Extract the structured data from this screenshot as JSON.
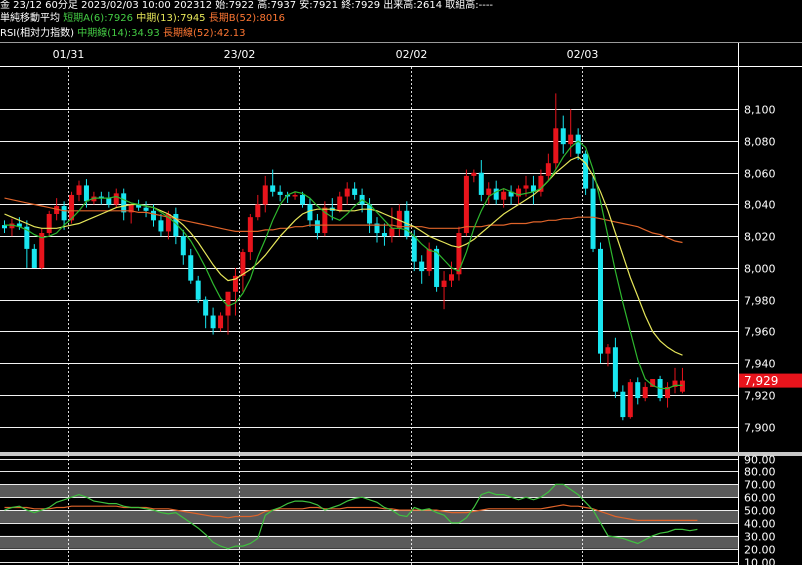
{
  "header": {
    "line1": "金 23/12 60分足 2023/02/03 10:00 202312 始:7922 高:7937 安:7921 終:7929 出来高:2614 取組高:----",
    "ma_title": "単純移動平均",
    "ma_short": "短期A(6):7926",
    "ma_mid": "中期(13):7945",
    "ma_long": "長期B(52):8016",
    "rsi_title": "RSI(相対力指数)",
    "rsi_mid": "中期線(14):34.93",
    "rsi_long": "長期線(52):42.13"
  },
  "colors": {
    "up": "#e8141c",
    "down": "#19e6f0",
    "ma_short": "#2eb82e",
    "ma_mid": "#e6e65a",
    "ma_long": "#e0642a",
    "rsi_mid": "#3fc13f",
    "rsi_long": "#e0642a",
    "grid": "#ffffff",
    "price_marker": "#e8141c"
  },
  "chart_data": [
    {
      "type": "candlestick",
      "x_dates": [
        {
          "label": "01/31",
          "index": 9
        },
        {
          "label": "23/02",
          "index": 32
        },
        {
          "label": "02/02",
          "index": 55
        },
        {
          "label": "02/03",
          "index": 78
        }
      ],
      "y_ticks": [
        "8,100",
        "8,080",
        "8,060",
        "8,040",
        "8,020",
        "8,000",
        "7,980",
        "7,960",
        "7,940",
        "7,920",
        "7,900"
      ],
      "ylim": [
        7884,
        8126
      ],
      "last_price_label": "7,929",
      "last_price": 7929,
      "candles": [
        [
          8027,
          8030,
          8022,
          8025
        ],
        [
          8025,
          8031,
          8020,
          8028
        ],
        [
          8028,
          8032,
          8024,
          8026
        ],
        [
          8026,
          8030,
          8000,
          8012
        ],
        [
          8012,
          8015,
          8000,
          8000
        ],
        [
          8000,
          8025,
          7999,
          8022
        ],
        [
          8022,
          8036,
          8020,
          8034
        ],
        [
          8034,
          8044,
          8030,
          8039
        ],
        [
          8039,
          8042,
          8024,
          8030
        ],
        [
          8030,
          8048,
          8028,
          8046
        ],
        [
          8046,
          8055,
          8042,
          8052
        ],
        [
          8052,
          8056,
          8038,
          8042
        ],
        [
          8042,
          8048,
          8040,
          8045
        ],
        [
          8045,
          8048,
          8040,
          8044
        ],
        [
          8044,
          8048,
          8038,
          8040
        ],
        [
          8040,
          8050,
          8038,
          8047
        ],
        [
          8047,
          8050,
          8030,
          8035
        ],
        [
          8035,
          8040,
          8028,
          8040
        ],
        [
          8040,
          8043,
          8036,
          8038
        ],
        [
          8038,
          8042,
          8032,
          8036
        ],
        [
          8036,
          8040,
          8026,
          8030
        ],
        [
          8030,
          8034,
          8020,
          8023
        ],
        [
          8023,
          8036,
          8018,
          8034
        ],
        [
          8034,
          8038,
          8015,
          8020
        ],
        [
          8020,
          8024,
          8002,
          8008
        ],
        [
          8008,
          8012,
          7990,
          7992
        ],
        [
          7992,
          7995,
          7978,
          7980
        ],
        [
          7980,
          7982,
          7962,
          7970
        ],
        [
          7970,
          7975,
          7958,
          7962
        ],
        [
          7962,
          7972,
          7960,
          7970
        ],
        [
          7970,
          7982,
          7958,
          7985
        ],
        [
          7985,
          8000,
          7970,
          7995
        ],
        [
          7995,
          8012,
          7985,
          8010
        ],
        [
          8010,
          8034,
          8005,
          8032
        ],
        [
          8032,
          8046,
          8030,
          8040
        ],
        [
          8040,
          8058,
          8035,
          8052
        ],
        [
          8052,
          8062,
          8045,
          8048
        ],
        [
          8048,
          8052,
          8042,
          8046
        ],
        [
          8046,
          8048,
          8041,
          8045
        ],
        [
          8045,
          8048,
          8043,
          8046
        ],
        [
          8046,
          8048,
          8038,
          8040
        ],
        [
          8040,
          8044,
          8026,
          8030
        ],
        [
          8030,
          8034,
          8018,
          8022
        ],
        [
          8022,
          8042,
          8020,
          8038
        ],
        [
          8038,
          8044,
          8030,
          8036
        ],
        [
          8036,
          8048,
          8035,
          8045
        ],
        [
          8045,
          8054,
          8040,
          8050
        ],
        [
          8050,
          8054,
          8043,
          8046
        ],
        [
          8046,
          8050,
          8035,
          8040
        ],
        [
          8040,
          8044,
          8022,
          8028
        ],
        [
          8028,
          8032,
          8016,
          8022
        ],
        [
          8022,
          8028,
          8014,
          8020
        ],
        [
          8020,
          8038,
          8016,
          8025
        ],
        [
          8025,
          8040,
          8020,
          8036
        ],
        [
          8036,
          8042,
          8018,
          8020
        ],
        [
          8020,
          8024,
          7998,
          8004
        ],
        [
          8004,
          8008,
          7990,
          7998
        ],
        [
          7998,
          8016,
          7995,
          8012
        ],
        [
          8012,
          8014,
          7985,
          7988
        ],
        [
          7988,
          7998,
          7974,
          7992
        ],
        [
          7992,
          8004,
          7988,
          7996
        ],
        [
          7996,
          8026,
          7992,
          8022
        ],
        [
          8022,
          8062,
          8020,
          8058
        ],
        [
          8058,
          8062,
          8054,
          8060
        ],
        [
          8060,
          8068,
          8042,
          8046
        ],
        [
          8046,
          8054,
          8040,
          8050
        ],
        [
          8050,
          8055,
          8040,
          8043
        ],
        [
          8043,
          8050,
          8038,
          8048
        ],
        [
          8048,
          8052,
          8040,
          8045
        ],
        [
          8045,
          8052,
          8040,
          8050
        ],
        [
          8050,
          8058,
          8045,
          8052
        ],
        [
          8052,
          8058,
          8040,
          8048
        ],
        [
          8048,
          8062,
          8045,
          8058
        ],
        [
          8058,
          8072,
          8055,
          8066
        ],
        [
          8066,
          8110,
          8062,
          8088
        ],
        [
          8088,
          8096,
          8072,
          8078
        ],
        [
          8078,
          8100,
          8070,
          8084
        ],
        [
          8084,
          8088,
          8068,
          8072
        ],
        [
          8072,
          8074,
          8046,
          8050
        ],
        [
          8050,
          8058,
          8010,
          8012
        ],
        [
          8012,
          8016,
          7940,
          7946
        ],
        [
          7946,
          7952,
          7938,
          7950
        ],
        [
          7950,
          7956,
          7918,
          7922
        ],
        [
          7922,
          7926,
          7904,
          7906
        ],
        [
          7906,
          7930,
          7905,
          7928
        ],
        [
          7928,
          7931,
          7914,
          7918
        ],
        [
          7918,
          7928,
          7916,
          7925
        ],
        [
          7925,
          7930,
          7925,
          7930
        ],
        [
          7930,
          7932,
          7916,
          7918
        ],
        [
          7918,
          7928,
          7912,
          7925
        ],
        [
          7925,
          7937,
          7921,
          7929
        ],
        [
          7922,
          7937,
          7921,
          7929
        ]
      ],
      "ma_short": [
        8027,
        8027,
        8026,
        8024,
        8021,
        8019,
        8020,
        8022,
        8027,
        8031,
        8036,
        8042,
        8044,
        8044,
        8044,
        8045,
        8043,
        8041,
        8040,
        8039,
        8038,
        8035,
        8032,
        8028,
        8023,
        8017,
        8009,
        8000,
        7990,
        7981,
        7976,
        7978,
        7984,
        7993,
        8007,
        8018,
        8030,
        8040,
        8046,
        8048,
        8047,
        8044,
        8039,
        8035,
        8032,
        8030,
        8034,
        8039,
        8043,
        8040,
        8035,
        8030,
        8025,
        8025,
        8024,
        8020,
        8015,
        8011,
        8010,
        8005,
        8000,
        7998,
        8010,
        8025,
        8036,
        8045,
        8048,
        8050,
        8048,
        8046,
        8047,
        8048,
        8050,
        8055,
        8062,
        8070,
        8076,
        8080,
        8076,
        8062,
        8042,
        8020,
        7998,
        7978,
        7960,
        7942,
        7930,
        7926,
        7924,
        7924,
        7926,
        7926
      ],
      "ma_mid": [
        8034,
        8032,
        8030,
        8028,
        8026,
        8025,
        8025,
        8025,
        8026,
        8027,
        8028,
        8030,
        8032,
        8034,
        8036,
        8038,
        8039,
        8040,
        8040,
        8039,
        8038,
        8036,
        8034,
        8031,
        8027,
        8022,
        8016,
        8009,
        8002,
        7996,
        7992,
        7993,
        7996,
        7999,
        8003,
        8008,
        8014,
        8020,
        8025,
        8030,
        8034,
        8036,
        8037,
        8037,
        8037,
        8036,
        8036,
        8036,
        8037,
        8037,
        8036,
        8034,
        8032,
        8030,
        8028,
        8026,
        8023,
        8020,
        8018,
        8016,
        8014,
        8013,
        8015,
        8018,
        8022,
        8026,
        8030,
        8034,
        8037,
        8040,
        8043,
        8046,
        8050,
        8055,
        8060,
        8064,
        8068,
        8070,
        8066,
        8058,
        8048,
        8036,
        8022,
        8008,
        7994,
        7982,
        7970,
        7960,
        7954,
        7950,
        7947,
        7945
      ],
      "ma_long": [
        8044,
        8043,
        8042,
        8041,
        8040,
        8039,
        8038,
        8037,
        8036,
        8036,
        8036,
        8036,
        8036,
        8036,
        8036,
        8036,
        8036,
        8036,
        8035,
        8035,
        8034,
        8033,
        8032,
        8031,
        8030,
        8029,
        8028,
        8027,
        8026,
        8025,
        8024,
        8023,
        8023,
        8023,
        8023,
        8024,
        8024,
        8025,
        8025,
        8026,
        8026,
        8027,
        8027,
        8027,
        8027,
        8027,
        8027,
        8027,
        8027,
        8027,
        8027,
        8027,
        8027,
        8026,
        8026,
        8026,
        8026,
        8025,
        8025,
        8025,
        8025,
        8025,
        8026,
        8026,
        8026,
        8027,
        8027,
        8027,
        8028,
        8028,
        8028,
        8029,
        8029,
        8030,
        8030,
        8031,
        8031,
        8032,
        8032,
        8032,
        8031,
        8030,
        8029,
        8028,
        8027,
        8026,
        8024,
        8022,
        8021,
        8019,
        8017,
        8016
      ]
    },
    {
      "type": "line",
      "y_ticks": [
        "90.00",
        "80.00",
        "70.00",
        "60.00",
        "50.00",
        "40.00",
        "30.00",
        "20.00",
        "10.00"
      ],
      "ylim": [
        5,
        92
      ],
      "bands": [
        [
          20,
          30
        ],
        [
          40,
          50
        ],
        [
          60,
          70
        ]
      ],
      "series": [
        {
          "values": [
            50,
            52,
            53,
            50,
            48,
            50,
            52,
            56,
            58,
            60,
            62,
            60,
            57,
            56,
            55,
            55,
            53,
            52,
            52,
            51,
            50,
            48,
            47,
            48,
            44,
            40,
            36,
            31,
            25,
            22,
            20,
            22,
            22,
            24,
            28,
            46,
            50,
            52,
            55,
            57,
            57,
            56,
            54,
            50,
            52,
            54,
            57,
            59,
            60,
            58,
            56,
            52,
            50,
            46,
            45,
            52,
            50,
            51,
            48,
            46,
            40,
            40,
            44,
            52,
            62,
            64,
            62,
            62,
            60,
            58,
            60,
            58,
            60,
            64,
            70,
            70,
            66,
            62,
            56,
            50,
            40,
            30,
            29,
            28,
            26,
            24,
            27,
            30,
            32,
            33,
            35,
            35,
            34,
            35
          ]
        },
        {
          "values": [
            52,
            52,
            52,
            52,
            51,
            51,
            51,
            52,
            52,
            53,
            53,
            53,
            53,
            53,
            53,
            53,
            52,
            52,
            52,
            52,
            51,
            51,
            51,
            50,
            49,
            48,
            47,
            46,
            45,
            45,
            44,
            45,
            45,
            45,
            46,
            49,
            50,
            51,
            51,
            51,
            51,
            52,
            52,
            51,
            51,
            51,
            52,
            52,
            52,
            52,
            52,
            51,
            51,
            50,
            50,
            50,
            50,
            50,
            50,
            49,
            48,
            48,
            48,
            49,
            50,
            51,
            51,
            51,
            51,
            51,
            51,
            51,
            51,
            52,
            53,
            54,
            53,
            53,
            52,
            51,
            49,
            47,
            45,
            44,
            43,
            42,
            42,
            42,
            42,
            42,
            42,
            42,
            42,
            42
          ]
        }
      ]
    }
  ]
}
